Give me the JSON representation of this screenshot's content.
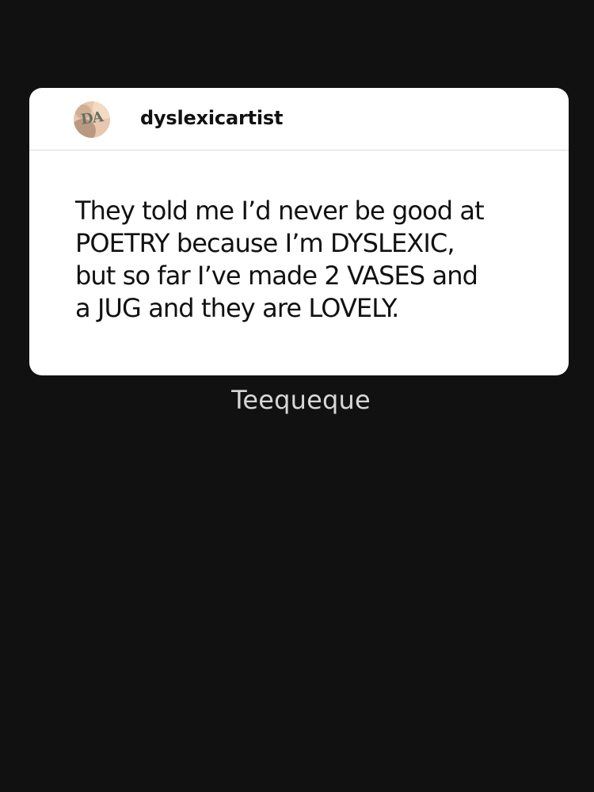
{
  "post": {
    "username": "dyslexicartist",
    "avatar_initials": "DA",
    "message_lines": [
      "They told me I’d never be good at",
      "POETRY because I’m DYSLEXIC,",
      "but so far I’ve made 2 VASES and",
      "a JUG and they are LOVELY."
    ]
  },
  "footer": {
    "artist_name": "Teequeque"
  },
  "colors": {
    "background": "#111111",
    "card": "#ffffff",
    "text": "#111111",
    "credit": "#d7d7d7"
  }
}
